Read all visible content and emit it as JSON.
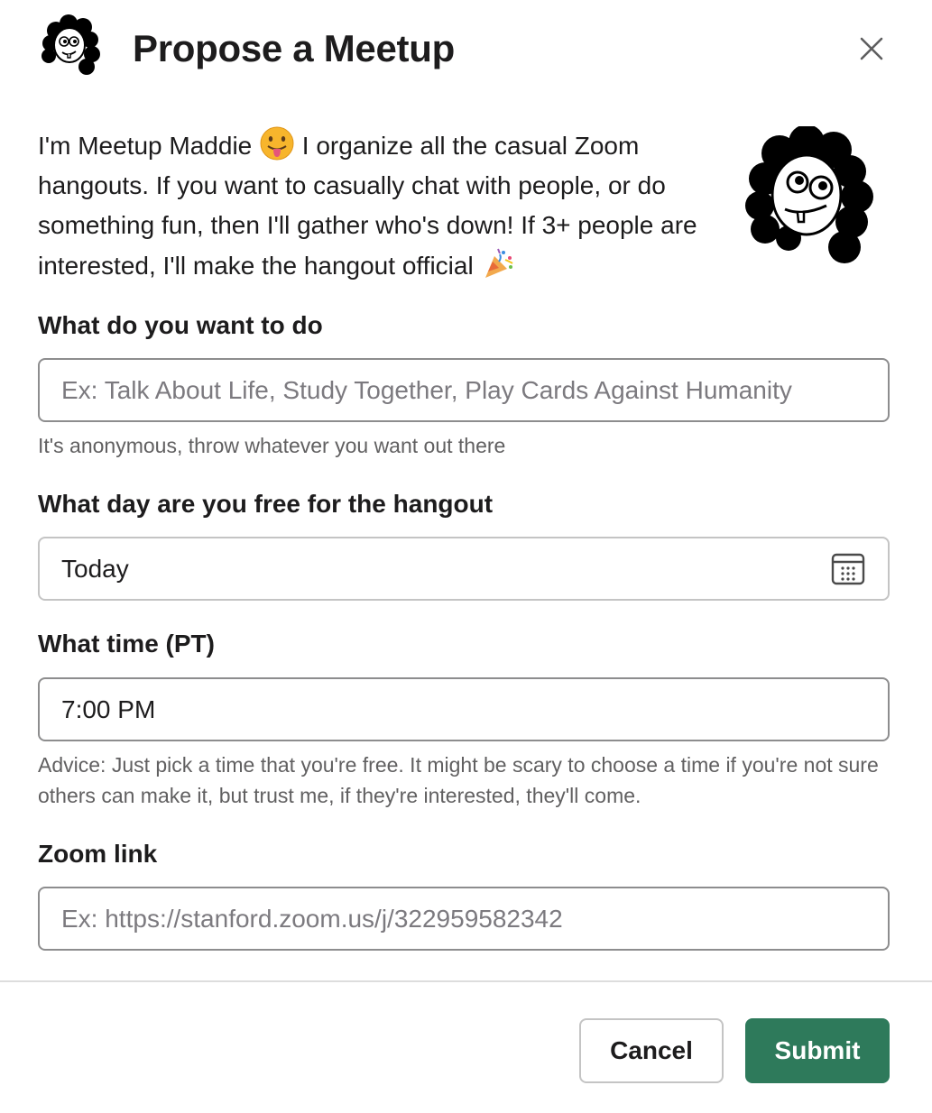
{
  "header": {
    "title": "Propose a Meetup",
    "avatar_icon": "maddie-avatar-icon",
    "close_icon": "close-icon"
  },
  "intro": {
    "part1": "I'm Meetup Maddie",
    "emoji1": "tongue-out-emoji",
    "part2": "I organize all the casual Zoom hangouts. If you want to casually chat with people, or do something fun, then I'll gather who's down! If 3+ people are interested, I'll make the hangout official",
    "emoji2": "party-popper-emoji"
  },
  "form": {
    "activity": {
      "label": "What do you want to do",
      "placeholder": "Ex: Talk About Life, Study Together, Play Cards Against Humanity",
      "value": "",
      "hint": "It's anonymous, throw whatever you want out there"
    },
    "day": {
      "label": "What day are you free for the hangout",
      "value": "Today",
      "icon": "calendar-icon"
    },
    "time": {
      "label": "What time (PT)",
      "value": "7:00 PM",
      "hint": "Advice: Just pick a time that you're free. It might be scary to choose a time if you're not sure others can make it, but trust me, if they're interested, they'll come."
    },
    "zoom": {
      "label": "Zoom link",
      "placeholder": "Ex: https://stanford.zoom.us/j/322959582342",
      "value": ""
    }
  },
  "footer": {
    "cancel_label": "Cancel",
    "submit_label": "Submit"
  },
  "colors": {
    "submit_bg": "#2e7a5b",
    "border": "#8d8d8e",
    "hint_text": "#616061"
  }
}
